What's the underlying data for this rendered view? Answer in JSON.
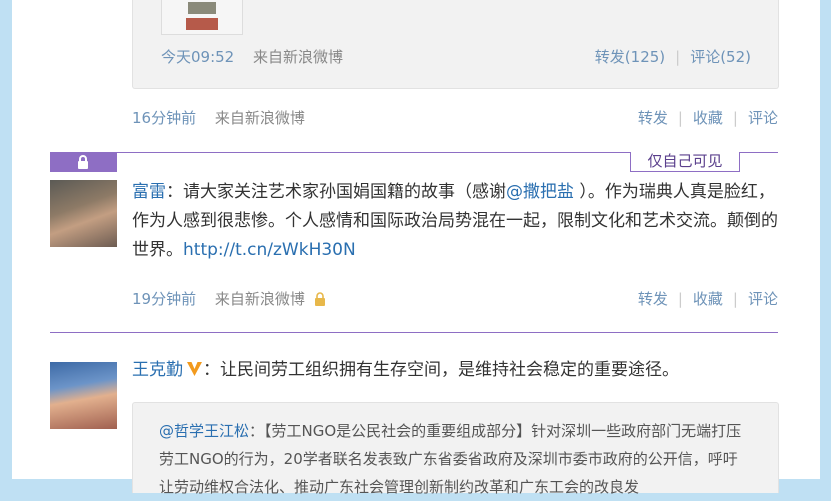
{
  "top_card": {
    "time": "今天09:52",
    "source": "来自新浪微博",
    "repost": "转发(125)",
    "comment": "评论(52)"
  },
  "post0_footer": {
    "time": "16分钟前",
    "source": "来自新浪微博",
    "repost": "转发",
    "favorite": "收藏",
    "comment": "评论"
  },
  "post1": {
    "private_label": "仅自己可见",
    "author": "富雷",
    "text_a": "：请大家关注艺术家孙国娟国籍的故事（感谢",
    "mention": "@撒把盐",
    "text_b": " ）。作为瑞典人真是脸红，作为人感到很悲惨。个人感情和国际政治局势混在一起，限制文化和艺术交流。颠倒的世界。",
    "link": "http://t.cn/zWkH30N",
    "footer": {
      "time": "19分钟前",
      "source": "来自新浪微博",
      "repost": "转发",
      "favorite": "收藏",
      "comment": "评论"
    }
  },
  "post2": {
    "author": "王克勤",
    "text": "：让民间劳工组织拥有生存空间，是维持社会稳定的重要途径。",
    "repost_author": "@哲学王江松",
    "repost_text": "：【劳工NGO是公民社会的重要组成部分】针对深圳一些政府部门无端打压劳工NGO的行为，20学者联名发表致广东省委省政府及深圳市委市政府的公开信，呼吁让劳动维权合法化、推动广东社会管理创新制约改革和广东工会的改良发"
  },
  "colors": {
    "accent": "#8e6ec4",
    "link": "#2a6fb0",
    "meta": "#6e93b8",
    "bg": "#bfe0f3"
  }
}
